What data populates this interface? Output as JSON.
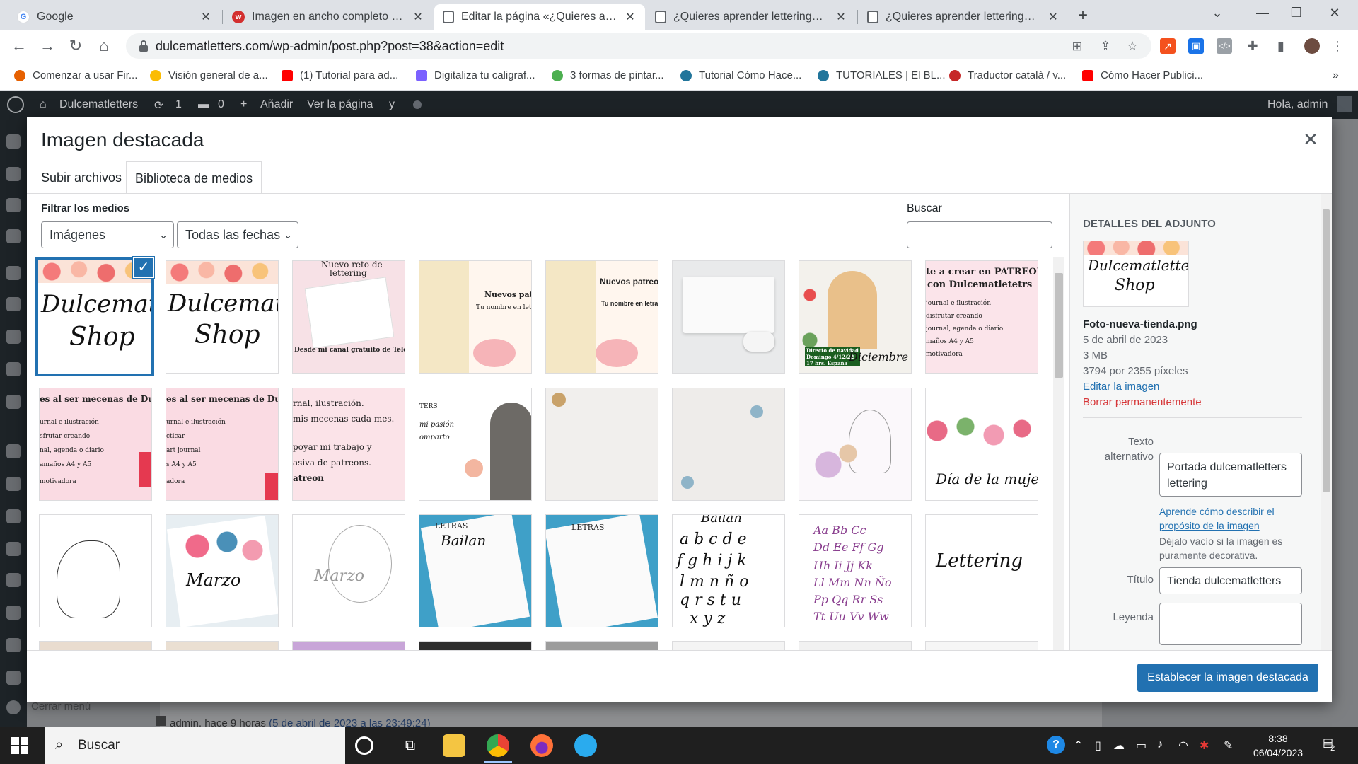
{
  "browser": {
    "tabs": [
      {
        "title": "Google",
        "color": "#ffffff",
        "letter": "G"
      },
      {
        "title": "Imagen en ancho completo – Pre",
        "color": "#d32f2f",
        "letter": "w"
      },
      {
        "title": "Editar la página «¿Quieres apren",
        "color": "#5f6368",
        "letter": ""
      },
      {
        "title": "¿Quieres aprender lettering? - D",
        "color": "#5f6368",
        "letter": ""
      },
      {
        "title": "¿Quieres aprender lettering? - D",
        "color": "#5f6368",
        "letter": ""
      }
    ],
    "url": "dulcematletters.com/wp-admin/post.php?post=38&action=edit",
    "bookmarks": [
      {
        "label": "Comenzar a usar Fir...",
        "color": "#e66000"
      },
      {
        "label": "Visión general de a...",
        "color": "#fbbc04"
      },
      {
        "label": "(1) Tutorial para ad...",
        "color": "#ff0000"
      },
      {
        "label": "Digitaliza tu caligraf...",
        "color": "#7b61ff"
      },
      {
        "label": "3 formas de pintar...",
        "color": "#4caf50"
      },
      {
        "label": "Tutorial Cómo Hace...",
        "color": "#21759b"
      },
      {
        "label": "TUTORIALES | El BL...",
        "color": "#21759b"
      },
      {
        "label": "Traductor català / v...",
        "color": "#c62828"
      },
      {
        "label": "Cómo Hacer Publici...",
        "color": "#ff0000"
      }
    ]
  },
  "wp_admin_bar": {
    "site_name": "Dulcematletters",
    "updates": "1",
    "comments": "0",
    "add_new": "Añadir",
    "view_page": "Ver la página",
    "greeting": "Hola, admin"
  },
  "behind": {
    "collapse_menu": "Cerrar menú",
    "revision_text": "admin, hace 9 horas",
    "revision_date": "(5 de abril de 2023 a las 23:49:24)"
  },
  "modal": {
    "title": "Imagen destacada",
    "close_icon": "close-icon",
    "tabs": [
      "Subir archivos",
      "Biblioteca de medios"
    ],
    "filter_label": "Filtrar los medios",
    "filter_type": "Imágenes",
    "filter_date": "Todas las fechas",
    "search_label": "Buscar",
    "search_value": "",
    "thumbs": {
      "t1": "Dulcematletters",
      "t1b": "Shop",
      "t3a": "Nuevo reto de",
      "t3b": "lettering",
      "t3c": "Desde mi canal gratuito de Telegram",
      "t4a": "Nuevos patre",
      "t4b": "Tu nombre en letr",
      "t5a": "Nuevos patreo",
      "t5b": "Tu nombre en letra",
      "t7a": "Directo de navidad",
      "t7b": "Domingo 4/12/22",
      "t7c": "17 hrs. España",
      "t7d": "Diciembre",
      "t8a": "te a crear en PATREON",
      "t8b": "con Dulcematletetrs",
      "t8c": "journal e ilustración",
      "t8d": "disfrutar creando",
      "t8e": "journal, agenda o diario",
      "t8f": "maños A4 y A5",
      "t8g": "motivadora",
      "t9a": "es al ser mecenas de Dulc",
      "t9b": "urnal e ilustración",
      "t9c": "sfrutar creando",
      "t9d": "nal, agenda o diario",
      "t9e": "amaños A4 y A5",
      "t9f": "motivadora",
      "t10a": "es al ser mecenas de Dulce",
      "t10b": "urnal e ilustración",
      "t10c": "cticar",
      "t10d": "art journal",
      "t10e": "s A4 y A5",
      "t10f": "adora",
      "t11a": "rnal, ilustración.",
      "t11b": "mis mecenas cada mes.",
      "t11c": "poyar mi trabajo y",
      "t11d": "asiva de patreons.",
      "t11e": "atreon",
      "t12a": "TERS",
      "t12b": "mi pasión",
      "t12c": "omparto",
      "t16": "Día de la mujer",
      "t18": "Marzo",
      "t19": "Marzo",
      "t20a": "LETRAS",
      "t20b": "Bailan",
      "t21": "LETRAS",
      "t22a": "Bailan",
      "t22b": "a b c d e",
      "t22c": "f g h i j k",
      "t22d": "l m n ñ o",
      "t22e": "q r s t u",
      "t22f": "x y z",
      "t23a": "Aa Bb Cc",
      "t23b": "Dd Ee Ff Gg",
      "t23c": "Hh Ii Jj Kk",
      "t23d": "Ll Mm Nn Ño",
      "t23e": "Pp Qq Rr Ss",
      "t23f": "Tt Uu Vv Ww",
      "t24": "Lettering"
    },
    "attachment": {
      "heading": "DETALLES DEL ADJUNTO",
      "thumb_text": "Dulcematletters",
      "thumb_text2": "Shop",
      "filename": "Foto-nueva-tienda.png",
      "date": "5 de abril de 2023",
      "size": "3 MB",
      "dimensions": "3794 por 2355 píxeles",
      "edit_link": "Editar la imagen",
      "delete_link": "Borrar permanentemente",
      "alt_label": "Texto alternativo",
      "alt_value": "Portada dulcematletters lettering",
      "alt_help_link": "Aprende cómo describir el propósito de la imagen",
      "alt_help_text": "Déjalo vacío si la imagen es puramente decorativa.",
      "title_label": "Título",
      "title_value": "Tienda dulcematletters",
      "caption_label": "Leyenda"
    },
    "set_button": "Establecer la imagen destacada"
  },
  "taskbar": {
    "search": "Buscar",
    "time": "8:38",
    "date": "06/04/2023",
    "notifications": "2"
  }
}
